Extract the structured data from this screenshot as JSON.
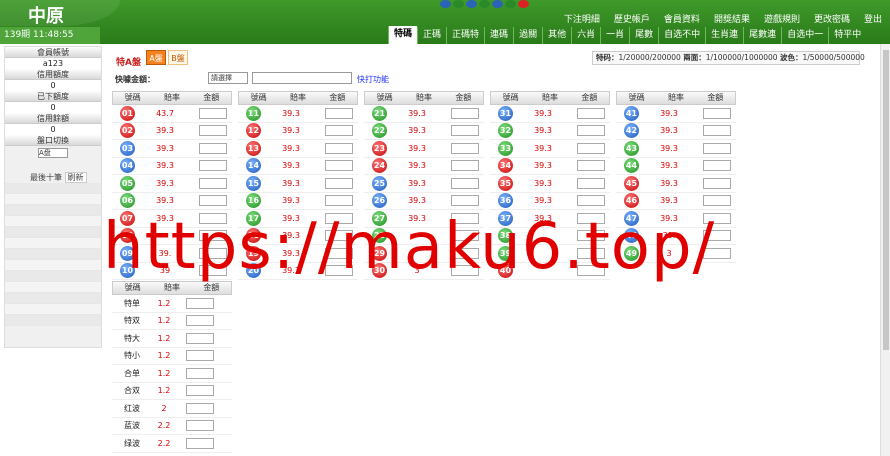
{
  "header": {
    "logo": "中原",
    "datetime": "139期 11:48:55",
    "menu": [
      "下注明細",
      "歷史帳戶",
      "會員資料",
      "開獎結果",
      "遊戲規則",
      "更改密碼",
      "登出"
    ]
  },
  "tabs": [
    "特碼",
    "正碼",
    "正碼特",
    "連碼",
    "過關",
    "其他",
    "六肖",
    "一肖",
    "尾數",
    "自选不中",
    "生肖連",
    "尾數連",
    "自选中一",
    "特平中"
  ],
  "sidebar": {
    "member_label": "會員帳號",
    "member_value": "a123",
    "credit_label": "信用額度",
    "credit_value": "0",
    "placed_label": "已下額度",
    "placed_value": "0",
    "balance_label": "信用餘額",
    "balance_value": "0",
    "switch_label": "盤口切換",
    "switch_value": "A盘",
    "last10_label": "最後十筆",
    "refresh_label": "刷新"
  },
  "content": {
    "title": "特A盤",
    "tab_a": "A盤",
    "tab_b": "B盤",
    "limits_1_label": "特码：",
    "limits_1_value": "1/20000/200000",
    "limits_2_label": "兩面：",
    "limits_2_value": "1/100000/1000000",
    "limits_3_label": "波色：",
    "limits_3_value": "1/50000/500000",
    "quick_label": "快噱金額：",
    "quick_select": "請選擇",
    "quick_link": "快打功能"
  },
  "columns": {
    "headers": [
      "號碼",
      "賠率",
      "金額"
    ],
    "col1": [
      {
        "num": "01",
        "odds": "43.7",
        "color": "red"
      },
      {
        "num": "02",
        "odds": "39.3",
        "color": "red"
      },
      {
        "num": "03",
        "odds": "39.3",
        "color": "blue"
      },
      {
        "num": "04",
        "odds": "39.3",
        "color": "blue"
      },
      {
        "num": "05",
        "odds": "39.3",
        "color": "green"
      },
      {
        "num": "06",
        "odds": "39.3",
        "color": "green"
      },
      {
        "num": "07",
        "odds": "39.3",
        "color": "red"
      },
      {
        "num": "08",
        "odds": "",
        "color": "red"
      },
      {
        "num": "09",
        "odds": "39.",
        "color": "blue"
      },
      {
        "num": "10",
        "odds": "39",
        "color": "blue"
      }
    ],
    "col2": [
      {
        "num": "11",
        "odds": "39.3",
        "color": "green"
      },
      {
        "num": "12",
        "odds": "39.3",
        "color": "red"
      },
      {
        "num": "13",
        "odds": "39.3",
        "color": "red"
      },
      {
        "num": "14",
        "odds": "39.3",
        "color": "blue"
      },
      {
        "num": "15",
        "odds": "39.3",
        "color": "blue"
      },
      {
        "num": "16",
        "odds": "39.3",
        "color": "green"
      },
      {
        "num": "17",
        "odds": "39.3",
        "color": "green"
      },
      {
        "num": "18",
        "odds": "39.3",
        "color": "red"
      },
      {
        "num": "19",
        "odds": "39.3",
        "color": "red"
      },
      {
        "num": "20",
        "odds": "39.3",
        "color": "blue"
      }
    ],
    "col3": [
      {
        "num": "21",
        "odds": "39.3",
        "color": "green"
      },
      {
        "num": "22",
        "odds": "39.3",
        "color": "green"
      },
      {
        "num": "23",
        "odds": "39.3",
        "color": "red"
      },
      {
        "num": "24",
        "odds": "39.3",
        "color": "red"
      },
      {
        "num": "25",
        "odds": "39.3",
        "color": "blue"
      },
      {
        "num": "26",
        "odds": "39.3",
        "color": "blue"
      },
      {
        "num": "27",
        "odds": "39.3",
        "color": "green"
      },
      {
        "num": "28",
        "odds": "",
        "color": "green"
      },
      {
        "num": "29",
        "odds": "",
        "color": "red"
      },
      {
        "num": "30",
        "odds": "3",
        "color": "red"
      }
    ],
    "col4": [
      {
        "num": "31",
        "odds": "39.3",
        "color": "blue"
      },
      {
        "num": "32",
        "odds": "39.3",
        "color": "green"
      },
      {
        "num": "33",
        "odds": "39.3",
        "color": "green"
      },
      {
        "num": "34",
        "odds": "39.3",
        "color": "red"
      },
      {
        "num": "35",
        "odds": "39.3",
        "color": "red"
      },
      {
        "num": "36",
        "odds": "39.3",
        "color": "blue"
      },
      {
        "num": "37",
        "odds": "39.3",
        "color": "blue"
      },
      {
        "num": "38",
        "odds": "",
        "color": "green"
      },
      {
        "num": "39",
        "odds": "",
        "color": "green"
      },
      {
        "num": "40",
        "odds": "",
        "color": "red"
      }
    ],
    "col5": [
      {
        "num": "41",
        "odds": "39.3",
        "color": "blue"
      },
      {
        "num": "42",
        "odds": "39.3",
        "color": "blue"
      },
      {
        "num": "43",
        "odds": "39.3",
        "color": "green"
      },
      {
        "num": "44",
        "odds": "39.3",
        "color": "green"
      },
      {
        "num": "45",
        "odds": "39.3",
        "color": "red"
      },
      {
        "num": "46",
        "odds": "39.3",
        "color": "red"
      },
      {
        "num": "47",
        "odds": "39.3",
        "color": "blue"
      },
      {
        "num": "48",
        "odds": "39.",
        "color": "blue"
      },
      {
        "num": "49",
        "odds": "3",
        "color": "green"
      }
    ]
  },
  "two_side": {
    "headers": [
      "號碼",
      "賠率",
      "金額"
    ],
    "rows": [
      {
        "name": "特单",
        "odds": "1.2"
      },
      {
        "name": "特双",
        "odds": "1.2"
      },
      {
        "name": "特大",
        "odds": "1.2"
      },
      {
        "name": "特小",
        "odds": "1.2"
      },
      {
        "name": "合单",
        "odds": "1.2"
      },
      {
        "name": "合双",
        "odds": "1.2"
      },
      {
        "name": "红波",
        "odds": "2"
      },
      {
        "name": "蓝波",
        "odds": "2.2"
      },
      {
        "name": "绿波",
        "odds": "2.2"
      }
    ]
  },
  "watermark": "https://maku6.top/"
}
